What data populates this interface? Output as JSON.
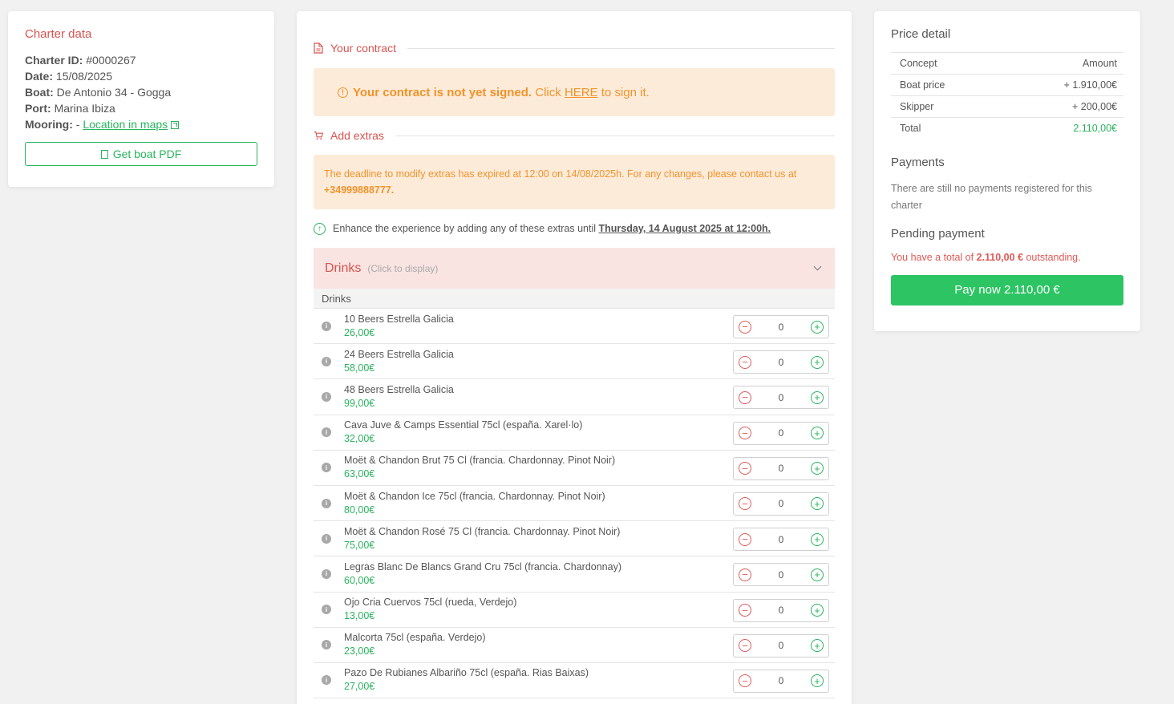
{
  "charter": {
    "title": "Charter data",
    "id_label": "Charter ID:",
    "id_value": "#0000267",
    "date_label": "Date:",
    "date_value": "15/08/2025",
    "boat_label": "Boat:",
    "boat_value": "De Antonio 34 - Gogga",
    "port_label": "Port:",
    "port_value": "Marina Ibiza",
    "mooring_label": "Mooring:",
    "mooring_prefix": "-",
    "mooring_link": "Location in maps",
    "pdf_button": "Get boat PDF"
  },
  "contract": {
    "section_label": "Your contract",
    "alert_strong": "Your contract is not yet signed.",
    "alert_pre": "Click",
    "alert_link": "HERE",
    "alert_post": "to sign it."
  },
  "extras": {
    "section_label": "Add extras",
    "deadline_pre": "The deadline to modify extras has expired at 12:00 on 14/08/2025h. For any changes, please contact us at",
    "deadline_phone": "+34999888777.",
    "enhance_pre": "Enhance the experience by adding any of these extras until",
    "enhance_date": "Thursday, 14 August 2025 at 12:00h.",
    "group_title": "Drinks",
    "group_hint": "(Click to display)",
    "subgroup": "Drinks",
    "items": [
      {
        "name": "10 Beers Estrella Galicia",
        "price": "26,00€",
        "qty": "0"
      },
      {
        "name": "24 Beers Estrella Galicia",
        "price": "58,00€",
        "qty": "0"
      },
      {
        "name": "48 Beers Estrella Galicia",
        "price": "99,00€",
        "qty": "0"
      },
      {
        "name": "Cava Juve & Camps Essential 75cl (españa. Xarel·lo)",
        "price": "32,00€",
        "qty": "0"
      },
      {
        "name": "Moët & Chandon Brut 75 Cl (francia. Chardonnay. Pinot Noir)",
        "price": "63,00€",
        "qty": "0"
      },
      {
        "name": "Moët & Chandon Ice 75cl (francia. Chardonnay. Pinot Noir)",
        "price": "80,00€",
        "qty": "0"
      },
      {
        "name": "Moët & Chandon Rosé 75 Cl (francia. Chardonnay. Pinot Noir)",
        "price": "75,00€",
        "qty": "0"
      },
      {
        "name": "Legras Blanc De Blancs Grand Cru 75cl (francia. Chardonnay)",
        "price": "60,00€",
        "qty": "0"
      },
      {
        "name": "Ojo Cria Cuervos 75cl (rueda, Verdejo)",
        "price": "13,00€",
        "qty": "0"
      },
      {
        "name": "Malcorta 75cl (españa. Verdejo)",
        "price": "23,00€",
        "qty": "0"
      },
      {
        "name": "Pazo De Rubianes Albariño 75cl (españa. Rias Baixas)",
        "price": "27,00€",
        "qty": "0"
      }
    ]
  },
  "price": {
    "title": "Price detail",
    "col_concept": "Concept",
    "col_amount": "Amount",
    "rows": [
      {
        "concept": "Boat price",
        "amount": "+ 1.910,00€"
      },
      {
        "concept": "Skipper",
        "amount": "+ 200,00€"
      },
      {
        "concept": "Total",
        "amount": "2.110,00€"
      }
    ],
    "payments_title": "Payments",
    "payments_text": "There are still no payments registered for this charter",
    "pending_title": "Pending payment",
    "pending_pre": "You have a total of",
    "pending_amount": "2.110,00 €",
    "pending_post": "outstanding.",
    "pay_button": "Pay now 2.110,00 €"
  },
  "colors": {
    "accent_red": "#d9534f",
    "accent_green": "#2ab35e",
    "warning": "#f0932b",
    "pay_button": "#2dc464"
  },
  "icons": {
    "info": "info-icon",
    "minus": "minus-circle-icon",
    "plus": "plus-circle-icon",
    "chevron": "chevron-down-icon"
  }
}
